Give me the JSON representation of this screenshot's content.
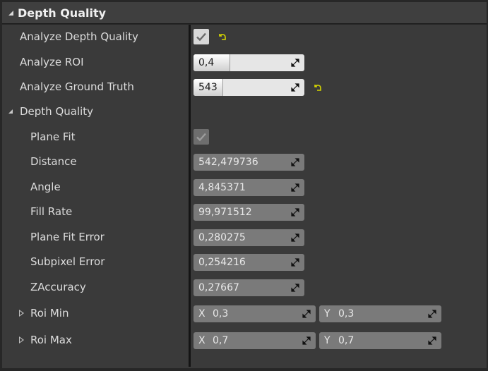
{
  "header": {
    "title": "Depth Quality"
  },
  "rows": {
    "analyze_depth_quality": {
      "label": "Analyze Depth Quality",
      "checked": true
    },
    "analyze_roi": {
      "label": "Analyze ROI",
      "value": "0,4"
    },
    "analyze_ground_truth": {
      "label": "Analyze Ground Truth",
      "value": "543"
    }
  },
  "section": {
    "label": "Depth Quality",
    "plane_fit": {
      "label": "Plane Fit",
      "checked": true
    },
    "distance": {
      "label": "Distance",
      "value": "542,479736"
    },
    "angle": {
      "label": "Angle",
      "value": "4,845371"
    },
    "fill_rate": {
      "label": "Fill Rate",
      "value": "99,971512"
    },
    "plane_fit_error": {
      "label": "Plane Fit Error",
      "value": "0,280275"
    },
    "subpixel_error": {
      "label": "Subpixel Error",
      "value": "0,254216"
    },
    "zaccuracy": {
      "label": "ZAccuracy",
      "value": "0,27667"
    },
    "roi_min": {
      "label": "Roi Min",
      "x_label": "X",
      "x": "0,3",
      "y_label": "Y",
      "y": "0,3"
    },
    "roi_max": {
      "label": "Roi Max",
      "x_label": "X",
      "x": "0,7",
      "y_label": "Y",
      "y": "0,7"
    }
  },
  "icons": {
    "reset": "reset-to-default-icon",
    "drag": "drag-arrows-icon",
    "check": "checkmark-icon"
  },
  "colors": {
    "reset_arrow": "#c8c800",
    "panel": "#3a3a3a",
    "header": "#3f3f3f"
  }
}
